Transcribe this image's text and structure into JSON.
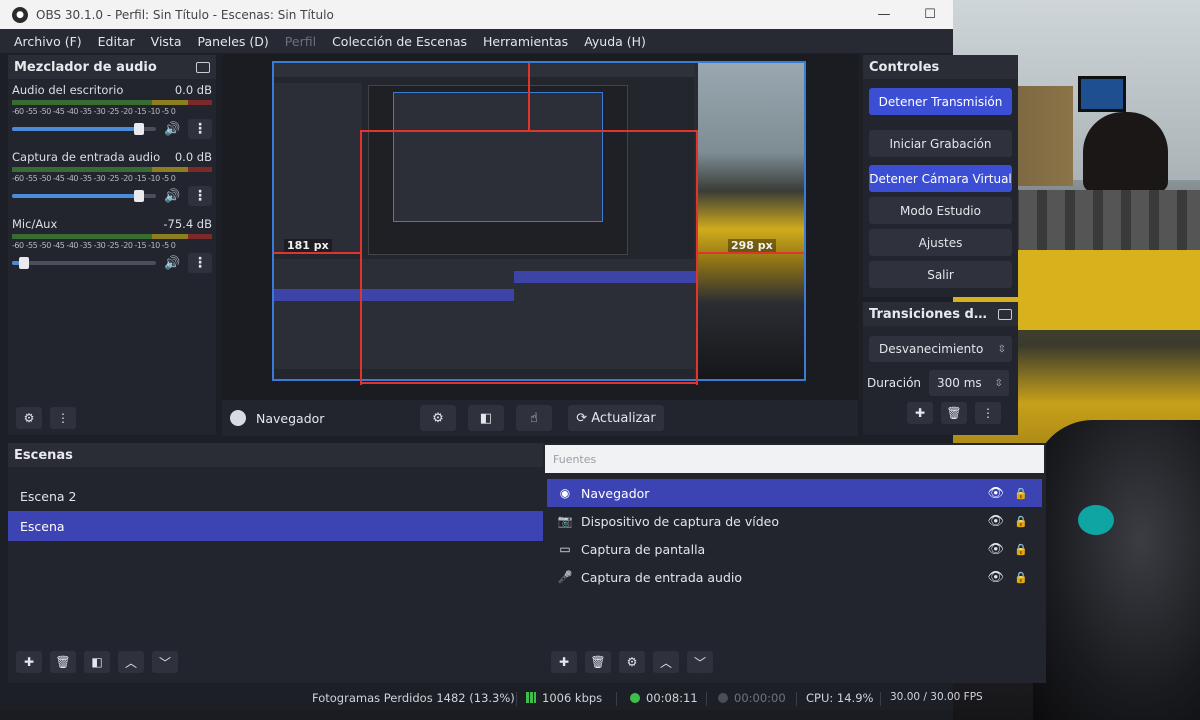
{
  "window": {
    "title": "OBS 30.1.0 - Perfil: Sin Título - Escenas: Sin Título"
  },
  "menu": [
    "Archivo (F)",
    "Editar",
    "Vista",
    "Paneles (D)",
    "Perfil",
    "Colección de Escenas",
    "Herramientas",
    "Ayuda (H)"
  ],
  "mixer": {
    "title": "Mezclador de audio",
    "channels": [
      {
        "name": "Audio del escritorio",
        "db": "0.0 dB",
        "volume": 0.88
      },
      {
        "name": "Captura de entrada audio",
        "db": "0.0 dB",
        "volume": 0.88
      },
      {
        "name": "Mic/Aux",
        "db": "-75.4 dB",
        "volume": 0.08
      }
    ],
    "ticks": "-60 -55 -50 -45 -40 -35 -30 -25 -20 -15 -10 -5 0"
  },
  "preview": {
    "left_px": "181 px",
    "right_px": "298 px"
  },
  "source_toolbar": {
    "source_name": "Navegador",
    "refresh_label": "Actualizar"
  },
  "controls": {
    "title": "Controles",
    "buttons": [
      "Detener Transmisión",
      "Iniciar Grabación",
      "Detener Cámara Virtual",
      "Modo Estudio",
      "Ajustes",
      "Salir"
    ]
  },
  "transitions": {
    "title": "Transiciones de escena",
    "selected": "Desvanecimiento",
    "duration_label": "Duración",
    "duration": "300 ms"
  },
  "scenes": {
    "title": "Escenas",
    "items": [
      "Escena 2",
      "Escena"
    ],
    "selected_index": 1
  },
  "sources": {
    "filter_placeholder": "Fuentes",
    "items": [
      {
        "name": "Navegador",
        "icon": "globe-icon"
      },
      {
        "name": "Dispositivo de captura de vídeo",
        "icon": "camera-icon"
      },
      {
        "name": "Captura de pantalla",
        "icon": "monitor-icon"
      },
      {
        "name": "Captura de entrada audio",
        "icon": "microphone-icon"
      }
    ],
    "selected_index": 0
  },
  "status": {
    "dropped_frames": "Fotogramas Perdidos 1482 (13.3%)",
    "bitrate": "1006 kbps",
    "stream_time": "00:08:11",
    "rec_time": "00:00:00",
    "cpu": "CPU: 14.9%",
    "fps": "30.00 / 30.00 FPS"
  },
  "colors": {
    "accent": "#3c4fd4",
    "selected_row": "#3c44b3",
    "red_guides": "#e0342c",
    "preview_border": "#3a7bd5"
  }
}
